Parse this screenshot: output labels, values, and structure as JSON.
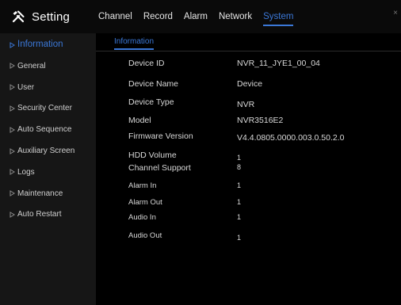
{
  "header": {
    "title": "Setting",
    "icon": "tools-icon",
    "close_glyph": "×"
  },
  "nav": {
    "tabs": [
      {
        "label": "Channel",
        "active": false
      },
      {
        "label": "Record",
        "active": false
      },
      {
        "label": "Alarm",
        "active": false
      },
      {
        "label": "Network",
        "active": false
      },
      {
        "label": "System",
        "active": true
      }
    ]
  },
  "sidebar": {
    "items": [
      {
        "label": "Information",
        "active": true
      },
      {
        "label": "General",
        "active": false
      },
      {
        "label": "User",
        "active": false
      },
      {
        "label": "Security Center",
        "active": false
      },
      {
        "label": "Auto Sequence",
        "active": false
      },
      {
        "label": "Auxiliary Screen",
        "active": false
      },
      {
        "label": "Logs",
        "active": false
      },
      {
        "label": "Maintenance",
        "active": false
      },
      {
        "label": "Auto Restart",
        "active": false
      }
    ]
  },
  "main": {
    "subtab": "Information",
    "rows": [
      {
        "label": "Device ID",
        "value": "NVR_11_JYE1_00_04"
      },
      {
        "label": "Device Name",
        "value": "Device"
      },
      {
        "label": "Device Type",
        "value": "NVR"
      },
      {
        "label": "Model",
        "value": "NVR3516E2"
      },
      {
        "label": "Firmware Version",
        "value": "V4.4.0805.0000.003.0.50.2.0"
      },
      {
        "label": "HDD Volume",
        "value": "1"
      },
      {
        "label": "Channel Support",
        "value": "8"
      },
      {
        "label": "Alarm In",
        "value": "1"
      },
      {
        "label": "Alarm Out",
        "value": "1"
      },
      {
        "label": "Audio In",
        "value": "1"
      },
      {
        "label": "Audio Out",
        "value": "1"
      }
    ]
  },
  "colors": {
    "accent": "#3b78d8",
    "background": "#000000",
    "sidebar": "#161616",
    "text": "#d8d8d8"
  }
}
